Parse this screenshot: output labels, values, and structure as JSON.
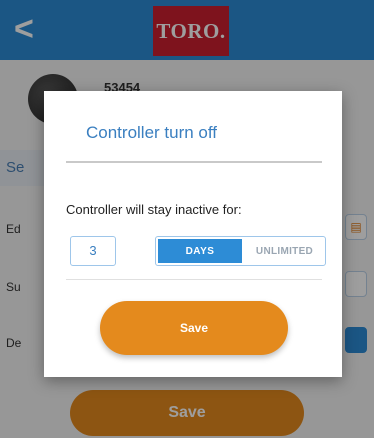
{
  "header": {
    "back_icon": "chevron-left-icon",
    "back_glyph": "<",
    "brand": "TORO."
  },
  "device": {
    "id": "53454"
  },
  "background": {
    "section_label": "Se",
    "rows": [
      "Ed",
      "Su",
      "De"
    ],
    "save_label": "Save"
  },
  "modal": {
    "title": "Controller turn off",
    "question": "Controller will stay inactive for:",
    "days_value": "3",
    "toggle": {
      "days_label": "DAYS",
      "unlimited_label": "UNLIMITED",
      "selected": "DAYS"
    },
    "save_label": "Save"
  },
  "colors": {
    "header_blue": "#2d8cd6",
    "brand_red": "#cc1f2f",
    "accent_orange": "#e48a1d",
    "title_blue": "#3a7fc0"
  }
}
